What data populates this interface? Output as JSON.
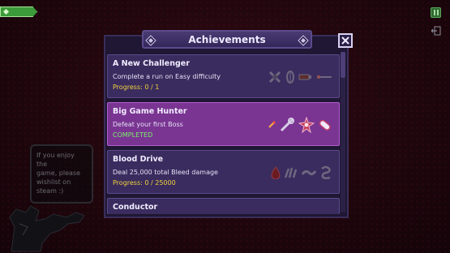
{
  "hud": {
    "currency_value": "",
    "pause_icon": "pause-icon",
    "exit_icon": "exit-door-icon"
  },
  "tip": {
    "lines": [
      "If you enjoy the",
      "game, please",
      "wishlist on",
      "steam :)"
    ]
  },
  "achievements": {
    "title": "Achievements",
    "close_icon": "close-x-icon",
    "items": [
      {
        "name": "A New Challenger",
        "description": "Complete a run on Easy difficulty",
        "status": "Progress: 0 / 1",
        "completed": false
      },
      {
        "name": "Big Game Hunter",
        "description": "Defeat your first Boss",
        "status": "COMPLETED",
        "completed": true
      },
      {
        "name": "Blood Drive",
        "description": "Deal 25,000 total Bleed damage",
        "status": "Progress: 0 / 25000",
        "completed": false
      },
      {
        "name": "Conductor",
        "description": "",
        "status": "",
        "completed": false
      }
    ]
  },
  "colors": {
    "panel": "#1f1733",
    "card": "#3a2c5e",
    "card_completed": "#7a3592",
    "progress_text": "#f2d23c",
    "completed_text": "#7bf06c",
    "hud_green": "#3b9b3a"
  }
}
